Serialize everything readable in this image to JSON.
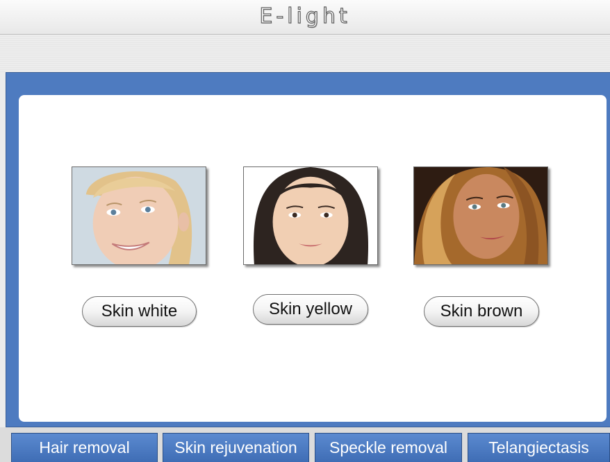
{
  "app": {
    "title": "E-light"
  },
  "skin_options": [
    {
      "label": "Skin white",
      "image_icon": "face-photo-fair-skin"
    },
    {
      "label": "Skin yellow",
      "image_icon": "face-photo-yellow-skin"
    },
    {
      "label": "Skin brown",
      "image_icon": "face-photo-brown-skin"
    }
  ],
  "tabs": [
    {
      "label": "Hair removal"
    },
    {
      "label": "Skin rejuvenation"
    },
    {
      "label": "Speckle removal"
    },
    {
      "label": "Telangiectasis"
    }
  ],
  "colors": {
    "accent_blue": "#4e7bc0",
    "tab_blue": "#4a7bc4",
    "panel_white": "#ffffff"
  }
}
